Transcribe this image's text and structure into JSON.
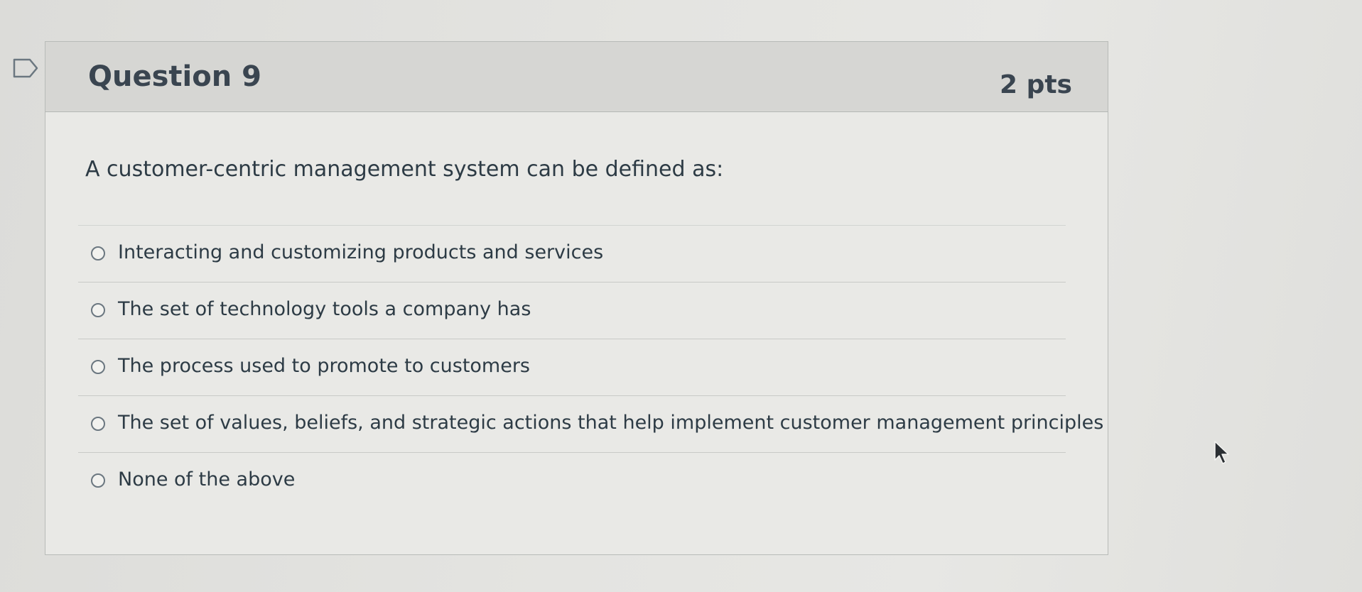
{
  "question": {
    "title": "Question 9",
    "points": "2 pts",
    "text": "A customer-centric management system can be defined as:"
  },
  "answers": [
    {
      "label": "Interacting and customizing products and services"
    },
    {
      "label": "The set of technology tools a company has"
    },
    {
      "label": "The process used to promote to customers"
    },
    {
      "label": "The set of values, beliefs, and strategic actions that help implement customer management principles"
    },
    {
      "label": "None of the above"
    }
  ],
  "icons": {
    "bookmark": "bookmark-flag-icon",
    "radio": "radio-button-icon",
    "cursor": "mouse-pointer-icon"
  },
  "colors": {
    "header_bg": "#d6d6d3",
    "card_bg": "#e9e9e6",
    "text": "#2d3b45"
  }
}
